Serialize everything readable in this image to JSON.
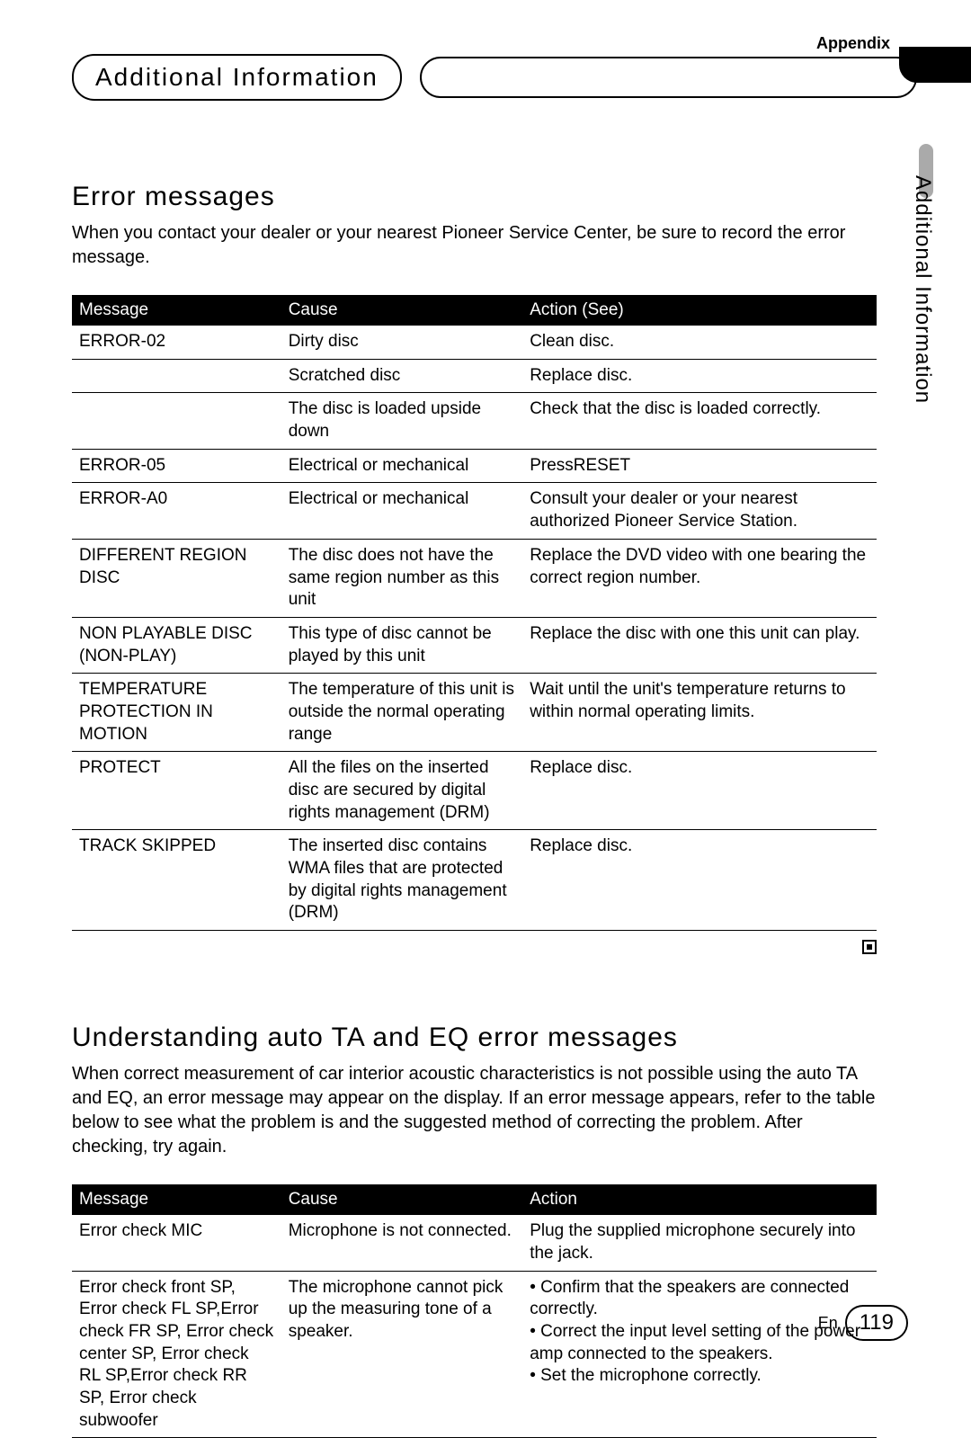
{
  "appendix": "Appendix",
  "header_pill": "Additional Information",
  "side_label": "Additional Information",
  "section1": {
    "title": "Error messages",
    "intro": "When you contact your dealer or your nearest Pioneer Service Center, be sure to record the error message.",
    "headers": {
      "msg": "Message",
      "cause": "Cause",
      "action": "Action (See)"
    },
    "rows": [
      {
        "msg": "ERROR-02",
        "cause": "Dirty disc",
        "action": "Clean disc."
      },
      {
        "msg": "",
        "cause": "Scratched disc",
        "action": "Replace disc."
      },
      {
        "msg": "",
        "cause": "The disc is loaded upside down",
        "action": "Check that the disc is loaded correctly."
      },
      {
        "msg": "ERROR-05",
        "cause": "Electrical or mechanical",
        "action": "PressRESET"
      },
      {
        "msg": "ERROR-A0",
        "cause": "Electrical or mechanical",
        "action": "Consult your dealer or your nearest authorized Pioneer Service Station."
      },
      {
        "msg": "DIFFERENT REGION DISC",
        "cause": "The disc does not have the same region number as this unit",
        "action": "Replace the DVD video with one bearing the correct region number."
      },
      {
        "msg": "NON PLAYABLE DISC (NON-PLAY)",
        "cause": "This type of disc cannot be played by this unit",
        "action": "Replace the disc with one this unit can play."
      },
      {
        "msg": "TEMPERATURE PROTECTION IN MOTION",
        "cause": "The temperature of this unit is outside the normal operating range",
        "action": "Wait until the unit's temperature returns to within normal operating limits."
      },
      {
        "msg": "PROTECT",
        "cause": "All the files on the inserted disc are secured by digital rights management (DRM)",
        "action": "Replace disc."
      },
      {
        "msg": "TRACK SKIPPED",
        "cause": "The inserted disc contains WMA files that are protected by digital rights management (DRM)",
        "action": "Replace disc."
      }
    ]
  },
  "section2": {
    "title": "Understanding auto TA and EQ error messages",
    "intro": "When correct measurement of car interior acoustic characteristics is not possible using the auto TA and EQ, an error message may appear on the display. If an error message appears, refer to the table below to see what the problem is and the suggested method of correcting the problem. After checking, try again.",
    "headers": {
      "msg": "Message",
      "cause": "Cause",
      "action": "Action"
    },
    "rows": [
      {
        "msg": "Error check MIC",
        "cause": "Microphone is not connected.",
        "action": "Plug the supplied microphone securely into the jack."
      },
      {
        "msg": "Error check front SP, Error check FL SP,Error check FR SP, Error check center SP, Error check RL SP,Error check RR SP, Error check subwoofer",
        "cause": "The microphone cannot pick up the measuring tone of a speaker.",
        "action": "• Confirm that the speakers are connected correctly.\n• Correct the input level setting of the power amp connected to the speakers.\n• Set the microphone correctly."
      }
    ]
  },
  "footer": {
    "lang": "En",
    "page": "119"
  }
}
